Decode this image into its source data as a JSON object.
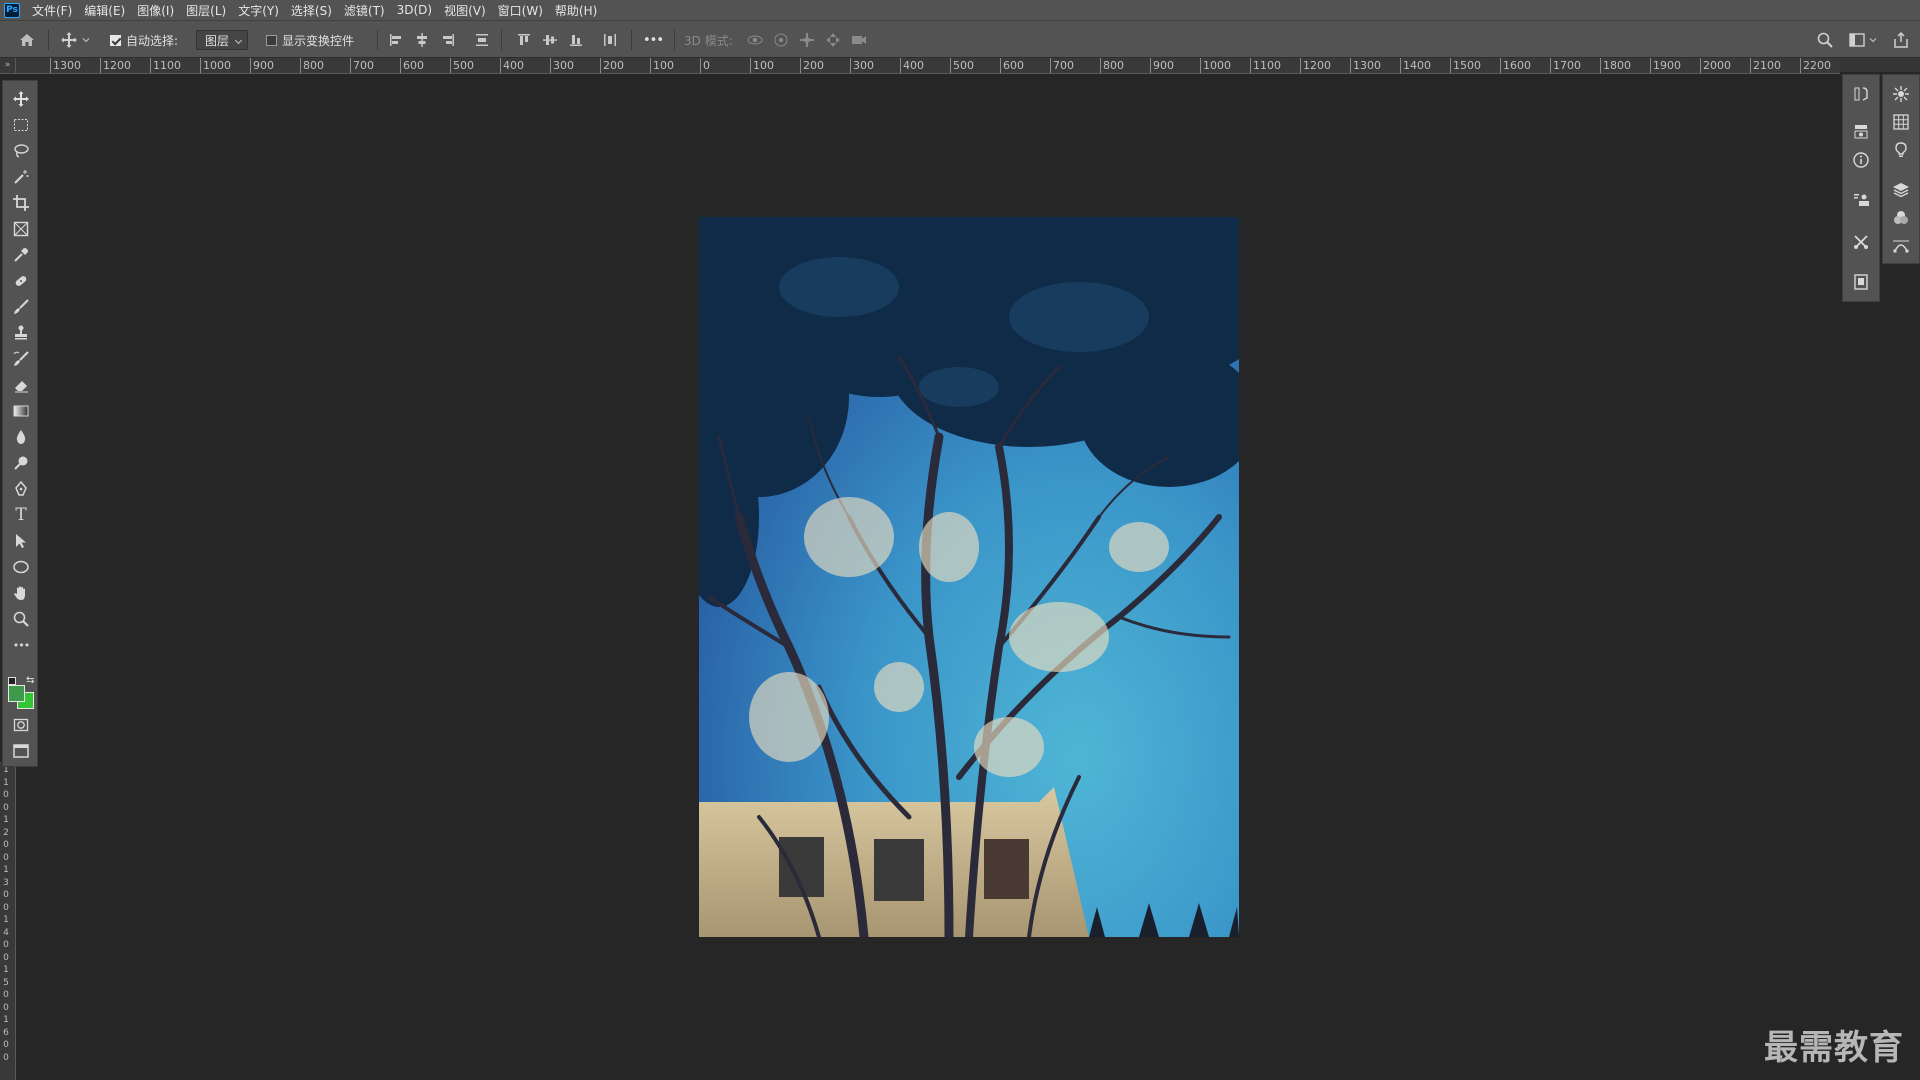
{
  "app": {
    "logo_text": "Ps"
  },
  "menubar": {
    "items": [
      {
        "label": "文件(F)"
      },
      {
        "label": "编辑(E)"
      },
      {
        "label": "图像(I)"
      },
      {
        "label": "图层(L)"
      },
      {
        "label": "文字(Y)"
      },
      {
        "label": "选择(S)"
      },
      {
        "label": "滤镜(T)"
      },
      {
        "label": "3D(D)"
      },
      {
        "label": "视图(V)"
      },
      {
        "label": "窗口(W)"
      },
      {
        "label": "帮助(H)"
      }
    ]
  },
  "options": {
    "auto_select_label": "自动选择:",
    "auto_select_checked": true,
    "auto_select_target": "图层",
    "show_transform_label": "显示变换控件",
    "show_transform_checked": false,
    "more_label": "•••",
    "mode_3d_label": "3D 模式:"
  },
  "rulers": {
    "corner_label": "»",
    "horizontal_labels": [
      "1300",
      "1200",
      "1100",
      "1000",
      "900",
      "800",
      "700",
      "600",
      "500",
      "400",
      "300",
      "200",
      "100",
      "0",
      "100",
      "200",
      "300",
      "400",
      "500",
      "600",
      "700",
      "800",
      "900",
      "1000",
      "1100",
      "1200",
      "1300",
      "1400",
      "1500",
      "1600",
      "1700",
      "1800",
      "1900",
      "2000",
      "2100",
      "2200"
    ],
    "vertical_labels": [
      "1",
      "1",
      "0",
      "0",
      "1",
      "2",
      "0",
      "0",
      "1",
      "3",
      "0",
      "0",
      "1",
      "4",
      "0",
      "0",
      "1",
      "5",
      "0",
      "0",
      "1",
      "6",
      "0",
      "0"
    ]
  },
  "toolbar": {
    "tools": [
      {
        "name": "move-tool-icon"
      },
      {
        "name": "rectangular-marquee-tool-icon"
      },
      {
        "name": "lasso-tool-icon"
      },
      {
        "name": "magic-wand-tool-icon"
      },
      {
        "name": "crop-tool-icon"
      },
      {
        "name": "frame-tool-icon"
      },
      {
        "name": "eyedropper-tool-icon"
      },
      {
        "name": "healing-brush-tool-icon"
      },
      {
        "name": "brush-tool-icon"
      },
      {
        "name": "clone-stamp-tool-icon"
      },
      {
        "name": "history-brush-tool-icon"
      },
      {
        "name": "eraser-tool-icon"
      },
      {
        "name": "gradient-tool-icon"
      },
      {
        "name": "blur-tool-icon"
      },
      {
        "name": "dodge-tool-icon"
      },
      {
        "name": "pen-tool-icon"
      },
      {
        "name": "type-tool-icon"
      },
      {
        "name": "path-selection-tool-icon"
      },
      {
        "name": "ellipse-tool-icon"
      },
      {
        "name": "hand-tool-icon"
      },
      {
        "name": "zoom-tool-icon"
      },
      {
        "name": "edit-toolbar-icon"
      }
    ],
    "type_tool_glyph": "T",
    "edit_toolbar_glyph": "•••",
    "swap_glyph": "⇆",
    "foreground_color": "#3d9a4b",
    "background_color": "#33c533"
  },
  "panels": {
    "dock1": [
      "history-icon",
      "properties-icon",
      "info-icon",
      "character-icon",
      "tools-preset-icon",
      "navigator-icon"
    ],
    "dock2": [
      "adjustments-icon",
      "swatches-icon",
      "learn-icon",
      "layers-icon",
      "channels-icon",
      "paths-icon"
    ]
  },
  "watermark": {
    "text": "最需教育"
  }
}
